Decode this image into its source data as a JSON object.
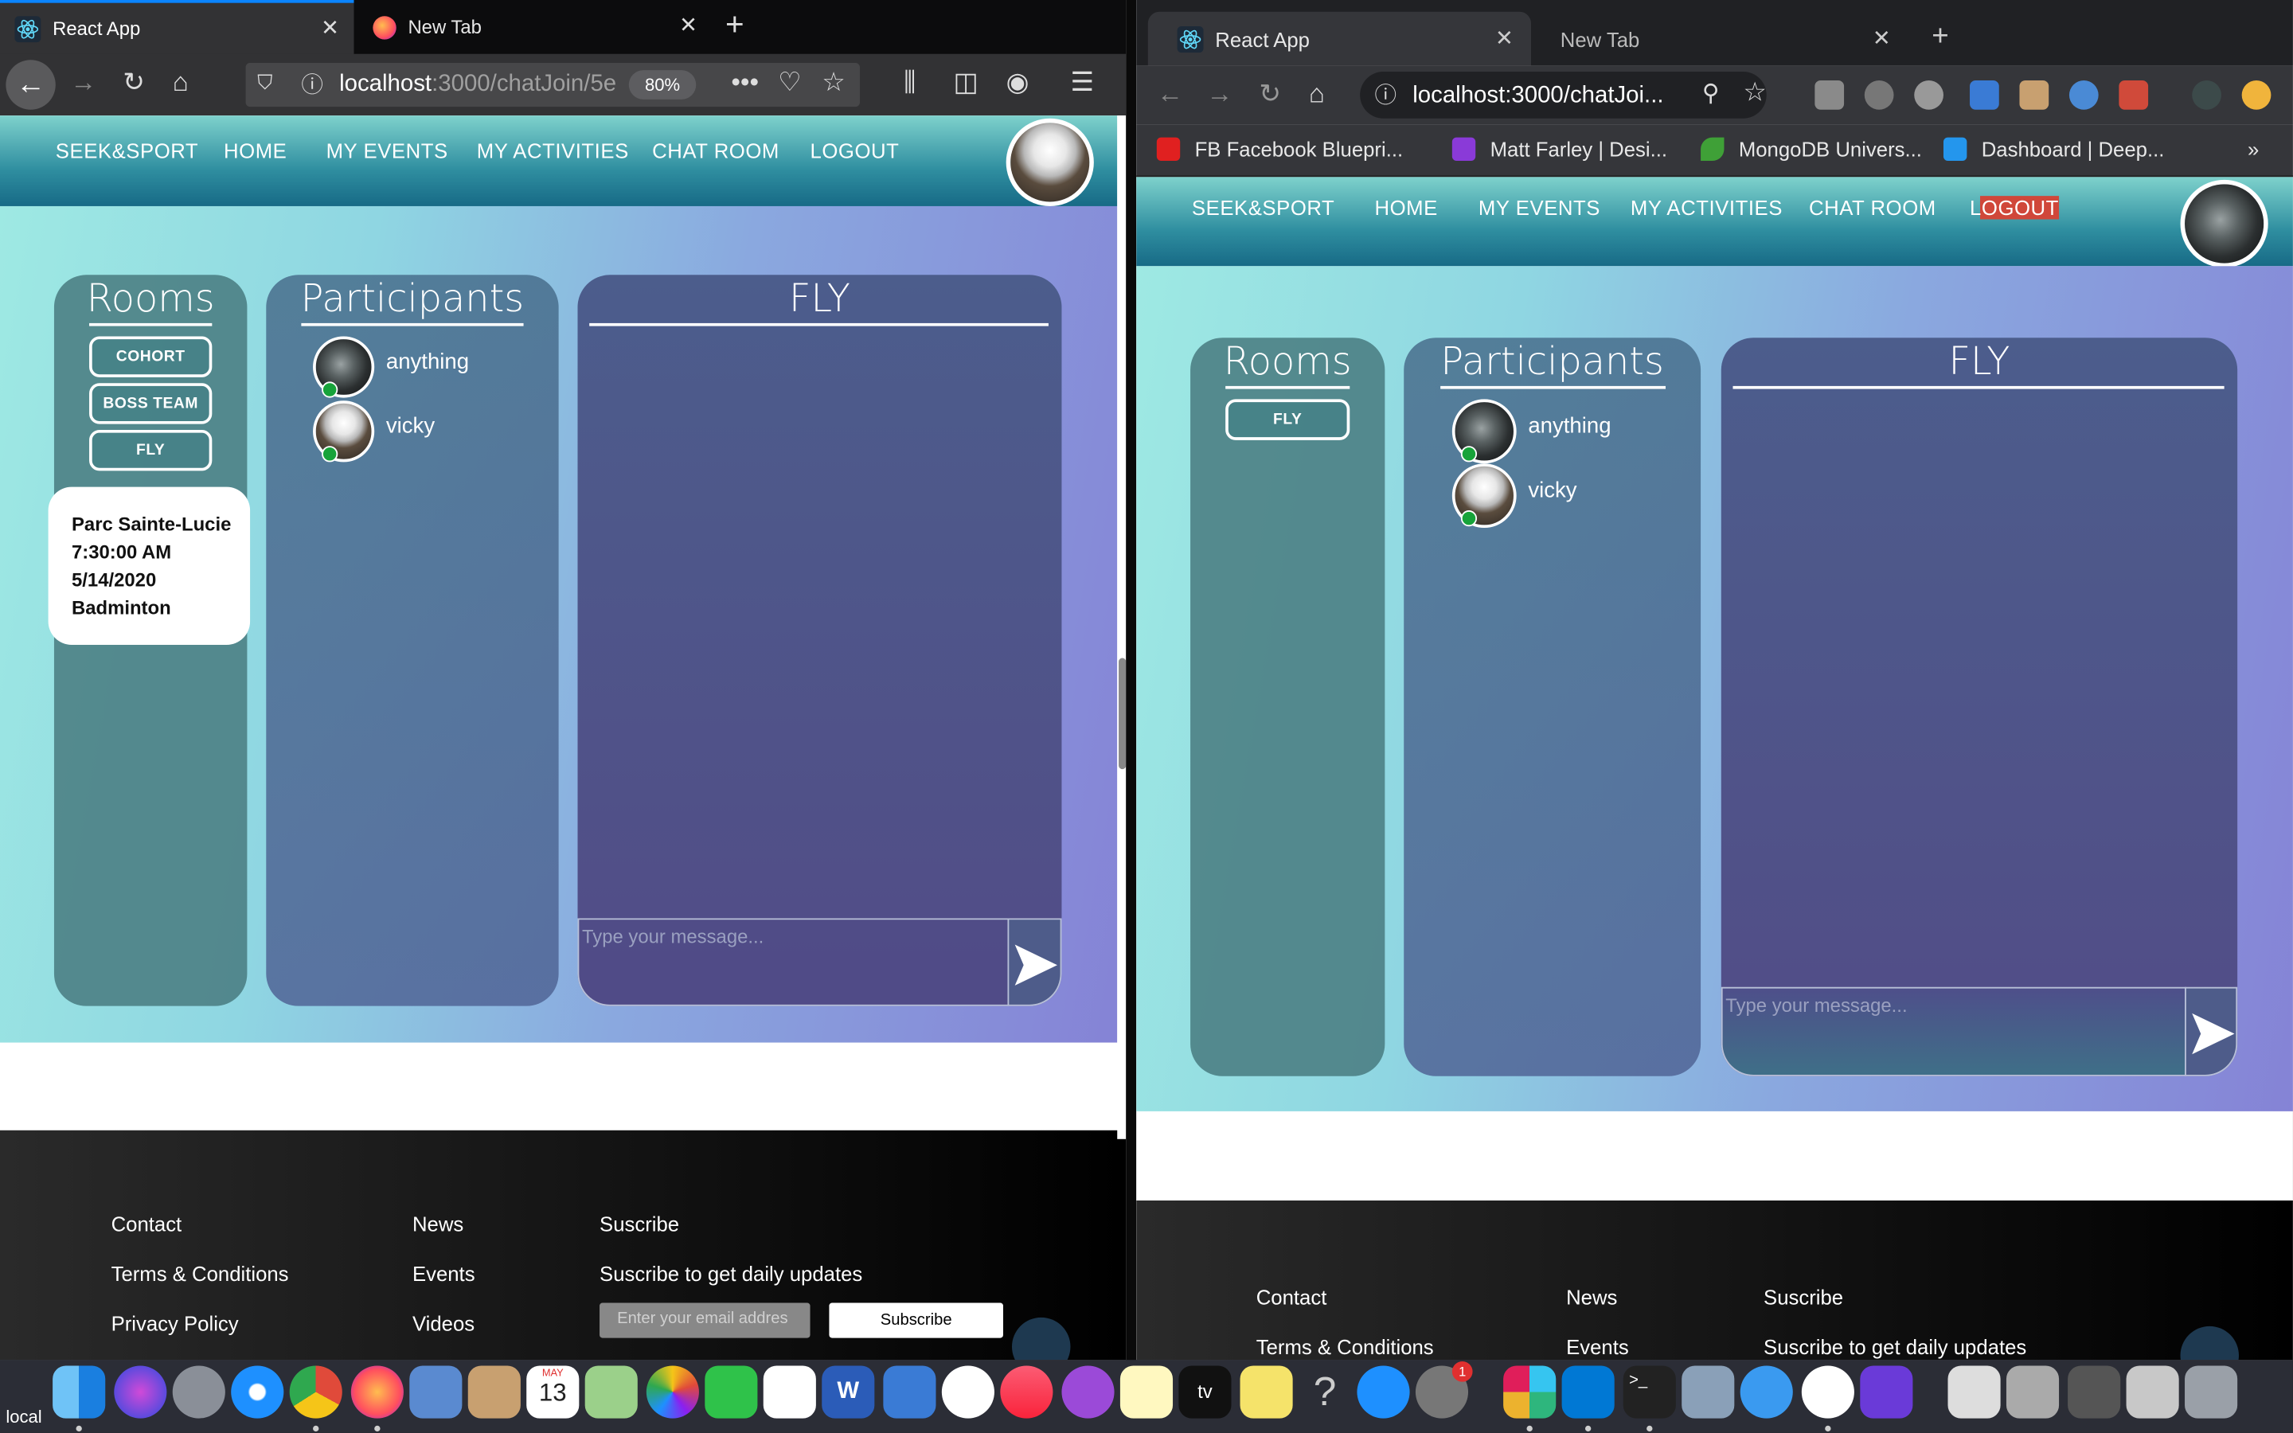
{
  "firefox": {
    "tabs": [
      {
        "label": "React App",
        "active": true
      },
      {
        "label": "New Tab",
        "active": false
      }
    ],
    "url": {
      "host": "localhost",
      "path": ":3000/chatJoin/5e"
    },
    "zoom": "80%"
  },
  "chrome": {
    "tabs": [
      {
        "label": "React App",
        "active": true
      },
      {
        "label": "New Tab",
        "active": false
      }
    ],
    "url": "localhost:3000/chatJoi...",
    "bookmarks": [
      {
        "label": "FB  Facebook Bluepri...",
        "icon": "youtube-icon"
      },
      {
        "label": "Matt Farley | Desi...",
        "icon": "matt-icon"
      },
      {
        "label": "MongoDB Univers...",
        "icon": "mongodb-leaf-icon"
      },
      {
        "label": "Dashboard | Deep...",
        "icon": "docker-icon"
      }
    ],
    "more": "»"
  },
  "app": {
    "brand": "SEEK&SPORT",
    "nav": [
      "HOME",
      "MY EVENTS",
      "MY ACTIVITIES",
      "CHAT ROOM",
      "LOGOUT"
    ],
    "rooms_title": "Rooms",
    "participants_title": "Participants",
    "chat_title": "FLY",
    "message_placeholder": "Type your message...",
    "left_rooms": [
      "COHORT",
      "BOSS TEAM",
      "FLY"
    ],
    "right_rooms": [
      "FLY"
    ],
    "participants": [
      {
        "name": "anything",
        "avatar": "dark-avatar",
        "online": true
      },
      {
        "name": "vicky",
        "avatar": "robot-avatar",
        "online": true
      }
    ],
    "tooltip": [
      "Parc Sainte-Lucie",
      "7:30:00 AM",
      "5/14/2020",
      "Badminton"
    ]
  },
  "footer": {
    "col1": [
      "Contact",
      "Terms & Conditions",
      "Privacy Policy"
    ],
    "col2": [
      "News",
      "Events",
      "Videos"
    ],
    "col3_title": "Suscribe",
    "col3_text": "Suscribe to get daily updates",
    "email_placeholder": "Enter your email addres",
    "subscribe_label": "Subscribe"
  },
  "dock": {
    "partial_label": "local",
    "calendar_month": "MAY",
    "calendar_day": "13",
    "tv_label": "tv",
    "badge": "1"
  },
  "colors": {
    "nav_gradient": "#2f8ea0",
    "body_start": "#9ee9e3",
    "body_end": "#8583d6",
    "online": "#17a33a",
    "firefox_accent": "#0a84ff"
  }
}
